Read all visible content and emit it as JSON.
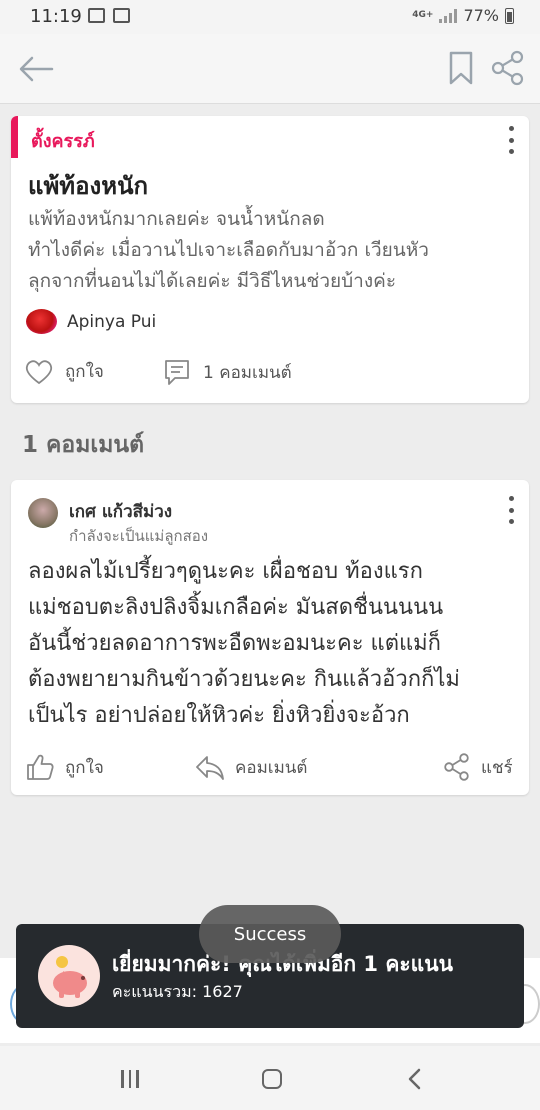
{
  "status_bar": {
    "time": "11:19",
    "network": "4G+",
    "battery": "77%"
  },
  "post": {
    "tag": "ตั้งครรภ์",
    "title": "แพ้ท้องหนัก",
    "body": "แพ้ท้องหนักมากเลยค่ะ จนน้ำหนักลด\nทำไงดีค่ะ เมื่อวานไปเจาะเลือดกับมาอ้วก เวียนหัว\nลุกจากที่นอนไม่ได้เลยค่ะ มีวิธีไหนช่วยบ้างค่ะ",
    "author": "Apinya Pui",
    "like_label": "ถูกใจ",
    "comment_label": "1 คอมเมนต์"
  },
  "comments_header": "1 คอมเมนต์",
  "comment": {
    "author": "เกศ แก้วสีม่วง",
    "subtitle": "กำลังจะเป็นแม่ลูกสอง",
    "body": "ลองผลไม้เปรี้ยวๆดูนะคะ เผื่อชอบ ท้องแรก\nแม่ชอบตะลิงปลิงจิ้มเกลือค่ะ มันสดชื่นนนนน\nอันนี้ช่วยลดอาการพะอืดพะอมนะคะ แต่แม่ก็\nต้องพยายามกินข้าวด้วยนะคะ กินแล้วอ้วกก็ไม่\nเป็นไร อย่าปล่อยให้หิวค่ะ ยิ่งหิวยิ่งจะอ้วก",
    "like_label": "ถูกใจ",
    "comment_label": "คอมเมนต์",
    "share_label": "แชร์"
  },
  "banner": {
    "title": "เยี่ยมมากค่ะ! คุณได้เพิ่มอีก 1 คะแนน",
    "subtitle": "คะแนนรวม: 1627"
  },
  "toast": "Success",
  "colors": {
    "accent": "#e8185b",
    "banner_bg": "#262a2e",
    "background": "#ededed"
  },
  "icons": [
    "back-arrow-icon",
    "bookmark-icon",
    "share-icon",
    "more-vert-icon",
    "heart-icon",
    "comment-icon",
    "thumbs-up-icon",
    "reply-icon",
    "piggy-bank-icon"
  ]
}
